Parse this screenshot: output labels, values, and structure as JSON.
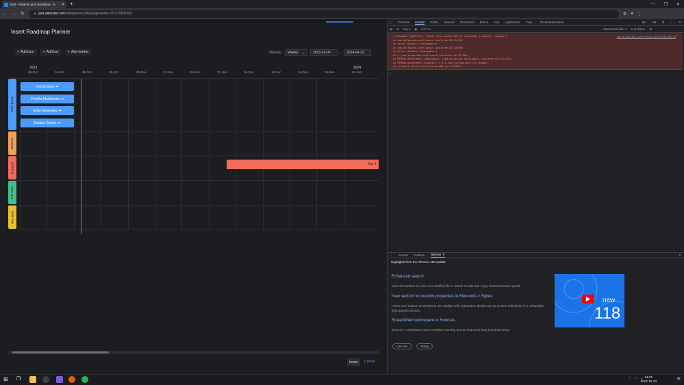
{
  "browser": {
    "tab_title": "Edit - Absents and Vacations - S",
    "new_tab": "+",
    "url_host": "jula.atlassian.net",
    "url_path": "/wiki/spaces/JWE/pages/edit-v2/1315831832",
    "window_controls": [
      "—",
      "❐",
      "✕"
    ]
  },
  "dialog": {
    "title": "Insert Roadmap Planner",
    "add_lane": "Add lane",
    "add_bar": "Add bar",
    "add_marker": "Add marker",
    "view_by_label": "View by",
    "view_by_value": "Weeks",
    "start_date": "2023-10-09",
    "date_sep": "-",
    "end_date": "2024-09-23",
    "insert": "Insert",
    "cancel": "Cancel"
  },
  "timeline": {
    "year_start": "2023",
    "year_next": "2024",
    "dates": [
      "09-Oct",
      "16-Oct",
      "25-Oct",
      "30-Oct",
      "06-Nov",
      "13-Nov",
      "20-Nov",
      "27-Nov",
      "04-Dec",
      "11-Dec",
      "18-Dec",
      "25-Dec",
      "01-Jan"
    ]
  },
  "lanes": [
    {
      "label": "Stefiz group",
      "color": "#4c9bff"
    },
    {
      "label": "Backend",
      "color": "#f0a05a"
    },
    {
      "label": "Frontend",
      "color": "#f26b5b"
    },
    {
      "label": "Test team",
      "color": "#3ec08a"
    },
    {
      "label": "Infra team",
      "color": "#e8c12c"
    }
  ],
  "people": [
    "Henrik Beck",
    "Pernilla Martinsson",
    "Sofia Kehlmeier",
    "Mattias Olsson"
  ],
  "bar": {
    "label": "Bar 1"
  },
  "devtools": {
    "tabs": [
      "Element",
      "Konsol",
      "Källor",
      "Nätverk",
      "Prestanda",
      "Minne",
      "App",
      "Lighthouse",
      "Insp...",
      "Prestandainsikter"
    ],
    "active_tab": "Konsol",
    "context": "top",
    "filter_placeholder": "Filtrera",
    "levels": "Standardnivåer",
    "problems": "5 problem",
    "errors_count": "1",
    "warnings_count": "5",
    "error_lines": [
      "▸ Uncaught TypeError: Cannot read properties of undefined (reading 'replace')",
      "    at com.atlassian.confluence.locale=en-US:23:764",
      "    at Array.forEach (<anonymous>)",
      "    at com.atlassian.confluence.locale=en-US:23:695",
      "    at Array.forEach (<anonymous>)",
      "    at n (com.atlassian.confluence.locale=en-US:23:664)",
      "    at HTMLButtonElement.<anonymous> (com.atlassian.confluence.locale=en-US:23:2170)",
      "    at HTMLButtonElement.dispatch (3.6.1-conf-custom-m03.js:2:43404)",
      "    at y.handle (3.6.1-conf-custom-m03.js:2:41395)"
    ],
    "error_source": "com.atlassian.confluence…locale=en-US:23",
    "drawer_tabs": [
      "Konsol",
      "Problem",
      "Nyheter"
    ],
    "drawer_active": "Nyheter",
    "drawer_heading": "Highlights from the Chrome 118 update",
    "news": [
      {
        "title": "Enhanced search",
        "body": "View all matches in a line of a minified file in search results and enjoy boosted search speed."
      },
      {
        "title": "New section for custom properties in Elements > Styles",
        "body": "Hover over custom properties to see tooltips with registration details and go to their definitions in a collapsible @properties section."
      },
      {
        "title": "Streamlined workspace in Sources",
        "body": "Sources > Workspace gets consistent naming and an improved drag-and-drop setup."
      }
    ],
    "promo_new": "new",
    "promo_num": "118",
    "learn_more": "Läs mer",
    "close": "Stäng"
  },
  "taskbar": {
    "time": "14:21",
    "date": "2023-10-23"
  }
}
